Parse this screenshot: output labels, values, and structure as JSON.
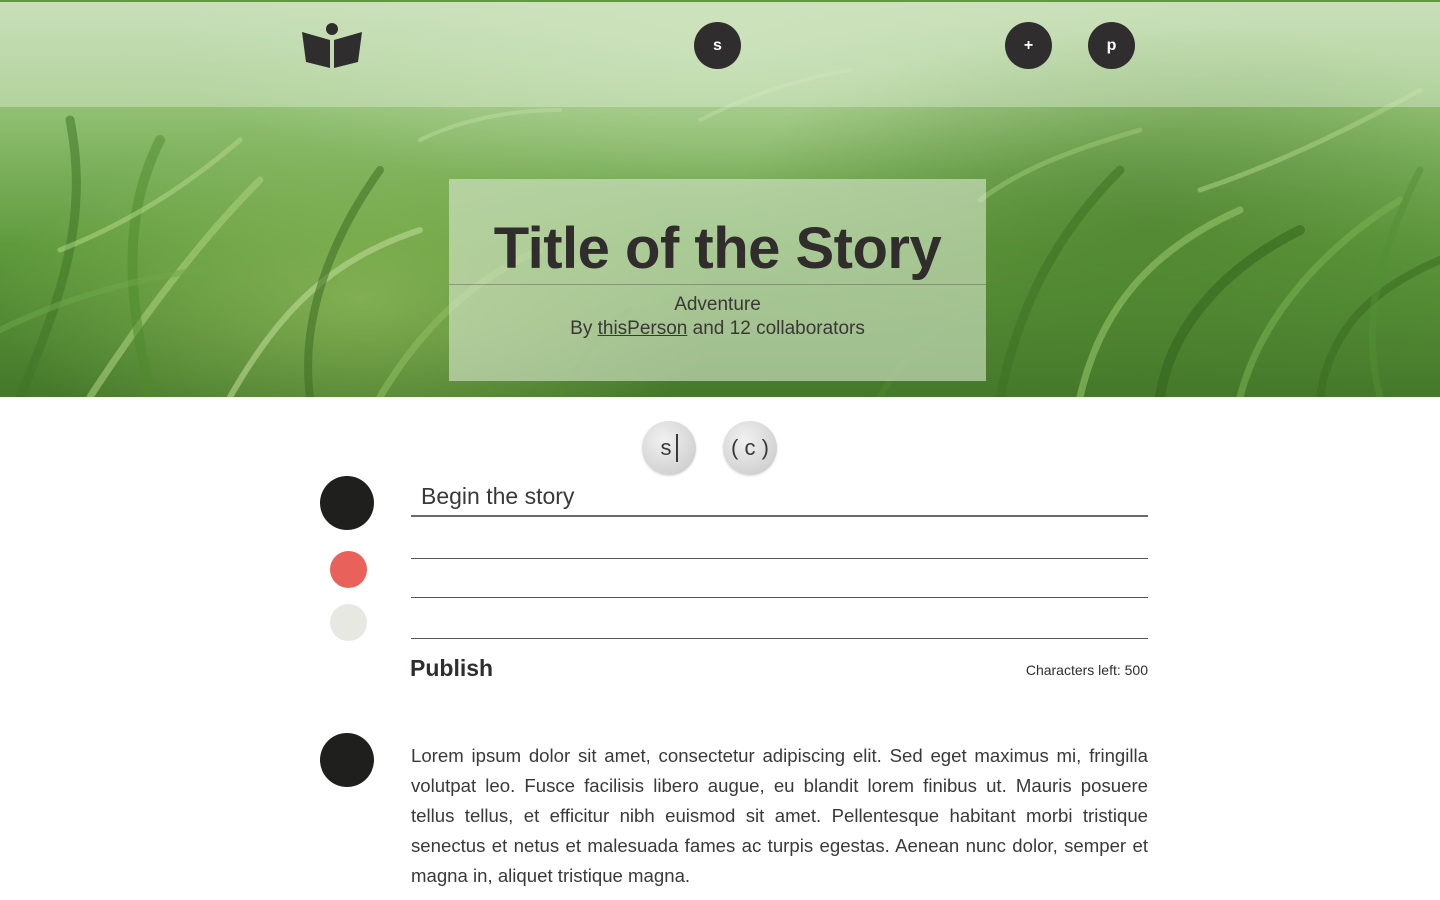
{
  "header": {
    "nav_buttons": {
      "search": "s",
      "add": "+",
      "profile": "p"
    }
  },
  "story": {
    "title": "Title of the Story",
    "genre": "Adventure",
    "byline_prefix": "By",
    "author": "thisPerson",
    "byline_suffix": "and 12 collaborators"
  },
  "toolbar": {
    "style_button": "s",
    "comment_button": "( c )"
  },
  "editor": {
    "placeholder": "Begin the story",
    "publish_label": "Publish",
    "chars_left_label": "Characters left: 500",
    "dot_colors": [
      "#1f1f1d",
      "#e8625b",
      "#e7e8e2"
    ]
  },
  "entry": {
    "text": "Lorem ipsum dolor sit amet, consectetur adipiscing elit. Sed eget maximus mi, fringilla volutpat leo. Fusce facilisis libero augue, eu blandit lorem finibus ut. Mauris posuere tellus tellus, et efficitur nibh euismod sit amet. Pellentesque habitant morbi tristique senectus et netus et malesuada fames ac turpis egestas. Aenean nunc dolor, semper et magna in, aliquet tristique magna."
  },
  "colors": {
    "accent_dark": "#2f2d2d",
    "accent_red": "#e8625b",
    "hero_green": "#5f9a3d"
  }
}
